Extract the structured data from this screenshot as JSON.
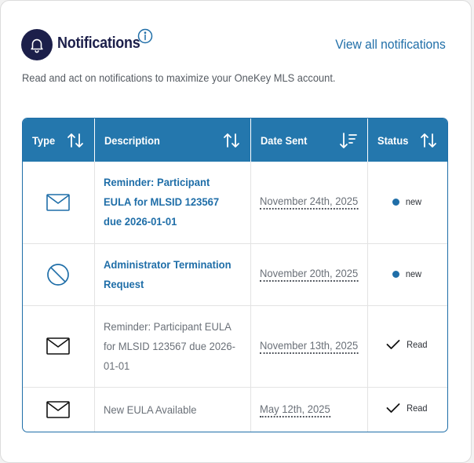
{
  "header": {
    "title": "Notifications",
    "view_all_label": "View all notifications",
    "subtitle": "Read and act on notifications to maximize your OneKey MLS account."
  },
  "table": {
    "columns": [
      {
        "label": "Type",
        "sort": "both"
      },
      {
        "label": "Description",
        "sort": "both"
      },
      {
        "label": "Date Sent",
        "sort": "desc"
      },
      {
        "label": "Status",
        "sort": "both"
      }
    ],
    "rows": [
      {
        "type_icon": "envelope-icon",
        "description": "Reminder: Participant EULA for MLSID 123567 due 2026-01-01",
        "date_sent": "November 24th, 2025",
        "status": "new",
        "read": false
      },
      {
        "type_icon": "prohibited-icon",
        "description": "Administrator Termination Request",
        "date_sent": "November 20th, 2025",
        "status": "new",
        "read": false
      },
      {
        "type_icon": "envelope-icon",
        "description": "Reminder: Participant EULA for MLSID 123567 due 2026-01-01",
        "date_sent": "November 13th, 2025",
        "status": "Read",
        "read": true
      },
      {
        "type_icon": "envelope-icon",
        "description": "New EULA Available",
        "date_sent": "May 12th, 2025",
        "status": "Read",
        "read": true
      }
    ]
  },
  "colors": {
    "accent": "#1f6ea8",
    "header_bg": "#2477ad",
    "brand_dark": "#1c1f4a"
  }
}
